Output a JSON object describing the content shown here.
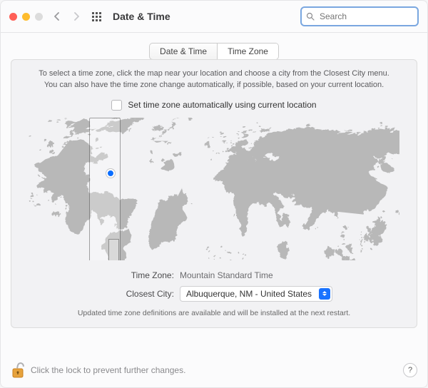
{
  "header": {
    "title": "Date & Time",
    "search_placeholder": "Search"
  },
  "tabs": {
    "dateTime": "Date & Time",
    "timeZone": "Time Zone"
  },
  "help": {
    "line1": "To select a time zone, click the map near your location and choose a city from the Closest City menu.",
    "line2": "You can also have the time zone change automatically, if possible, based on your current location."
  },
  "auto": {
    "label": "Set time zone automatically using current location",
    "checked": false
  },
  "fields": {
    "tz_label": "Time Zone:",
    "tz_value": "Mountain Standard Time",
    "city_label": "Closest City:",
    "city_value": "Albuquerque, NM - United States"
  },
  "update_note": "Updated time zone definitions are available and will be installed at the next restart.",
  "footer": {
    "lock_text": "Click the lock to prevent further changes.",
    "help_label": "?"
  }
}
